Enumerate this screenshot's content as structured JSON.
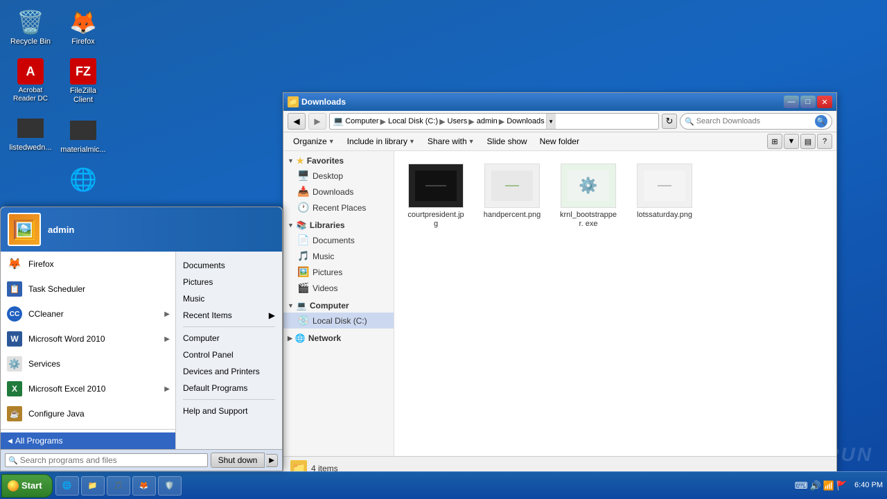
{
  "desktop": {
    "icons": [
      {
        "id": "recycle-bin",
        "label": "Recycle Bin",
        "icon": "🗑️",
        "col": 1
      },
      {
        "id": "acrobat",
        "label": "Acrobat\nReader DC",
        "icon": "A",
        "col": 1,
        "color": "#cc0000"
      },
      {
        "id": "listedwed",
        "label": "listedwedn...",
        "icon": "",
        "col": 1,
        "dark": true
      },
      {
        "id": "firefox",
        "label": "Firefox",
        "icon": "🦊",
        "col": 2
      },
      {
        "id": "filezilla",
        "label": "FileZilla Client",
        "icon": "F",
        "col": 2,
        "color": "#cc0000"
      },
      {
        "id": "material",
        "label": "materialmic...",
        "icon": "",
        "col": 2,
        "dark": true
      },
      {
        "id": "chrome",
        "label": "",
        "icon": "🌐",
        "col": 2
      },
      {
        "id": "word",
        "label": "",
        "icon": "W",
        "col": 2,
        "color": "#2b5797"
      }
    ]
  },
  "taskbar": {
    "start_label": "Start",
    "items": [
      {
        "id": "ie",
        "label": "",
        "icon": "🌐"
      },
      {
        "id": "explorer",
        "label": "",
        "icon": "📁"
      },
      {
        "id": "media",
        "label": "",
        "icon": "🎵"
      },
      {
        "id": "firefox-tb",
        "label": "",
        "icon": "🦊"
      },
      {
        "id": "shield",
        "label": "",
        "icon": "🛡️"
      }
    ],
    "time": "6:40 PM",
    "date": ""
  },
  "start_menu": {
    "user": {
      "name": "admin",
      "avatar_color": "#e8821a"
    },
    "left_items": [
      {
        "id": "firefox",
        "label": "Firefox",
        "icon": "🦊",
        "has_arrow": false
      },
      {
        "id": "task-scheduler",
        "label": "Task Scheduler",
        "icon": "📋",
        "has_arrow": false
      },
      {
        "id": "ccleaner",
        "label": "CCleaner",
        "icon": "🔵",
        "has_arrow": true
      },
      {
        "id": "word",
        "label": "Microsoft Word 2010",
        "icon": "W",
        "has_arrow": true
      },
      {
        "id": "services",
        "label": "Services",
        "icon": "⚙️",
        "has_arrow": false
      },
      {
        "id": "excel",
        "label": "Microsoft Excel 2010",
        "icon": "X",
        "has_arrow": true
      },
      {
        "id": "java",
        "label": "Configure Java",
        "icon": "☕",
        "has_arrow": false
      }
    ],
    "right_items": [
      {
        "id": "documents",
        "label": "Documents"
      },
      {
        "id": "pictures",
        "label": "Pictures"
      },
      {
        "id": "music",
        "label": "Music"
      },
      {
        "id": "recent-items",
        "label": "Recent Items",
        "has_arrow": true
      },
      {
        "id": "computer",
        "label": "Computer"
      },
      {
        "id": "control-panel",
        "label": "Control Panel"
      },
      {
        "id": "devices-printers",
        "label": "Devices and Printers"
      },
      {
        "id": "default-programs",
        "label": "Default Programs"
      },
      {
        "id": "help-support",
        "label": "Help and Support"
      }
    ],
    "all_programs_label": "All Programs",
    "search_placeholder": "Search programs and files",
    "shutdown_label": "Shut down"
  },
  "explorer": {
    "title": "Downloads",
    "breadcrumb": {
      "parts": [
        "Computer",
        "Local Disk (C:)",
        "Users",
        "admin",
        "Downloads"
      ]
    },
    "search_placeholder": "Search Downloads",
    "menu_items": [
      {
        "id": "organize",
        "label": "Organize",
        "has_arrow": true
      },
      {
        "id": "include-library",
        "label": "Include in library",
        "has_arrow": true
      },
      {
        "id": "share-with",
        "label": "Share with",
        "has_arrow": true
      },
      {
        "id": "slide-show",
        "label": "Slide show"
      },
      {
        "id": "new-folder",
        "label": "New folder"
      }
    ],
    "nav": {
      "favorites": {
        "label": "Favorites",
        "items": [
          {
            "id": "desktop",
            "label": "Desktop"
          },
          {
            "id": "downloads",
            "label": "Downloads"
          },
          {
            "id": "recent-places",
            "label": "Recent Places"
          }
        ]
      },
      "libraries": {
        "label": "Libraries",
        "items": [
          {
            "id": "documents",
            "label": "Documents"
          },
          {
            "id": "music",
            "label": "Music"
          },
          {
            "id": "pictures",
            "label": "Pictures"
          },
          {
            "id": "videos",
            "label": "Videos"
          }
        ]
      },
      "computer": {
        "label": "Computer",
        "items": [
          {
            "id": "local-disk",
            "label": "Local Disk (C:)",
            "active": true
          }
        ]
      },
      "network": {
        "label": "Network"
      }
    },
    "files": [
      {
        "id": "courtpresident",
        "name": "courtpresident.jpg",
        "type": "jpg",
        "dark": true
      },
      {
        "id": "handpercent",
        "name": "handpercent.png",
        "type": "png",
        "dark": false
      },
      {
        "id": "krnl",
        "name": "krnl_bootstrapper.\nexe",
        "type": "exe",
        "dark": false
      },
      {
        "id": "lotssaturday",
        "name": "lotssaturday.png",
        "type": "png",
        "dark": false
      }
    ],
    "status": "4 items"
  },
  "watermark": "ANY.RUN"
}
